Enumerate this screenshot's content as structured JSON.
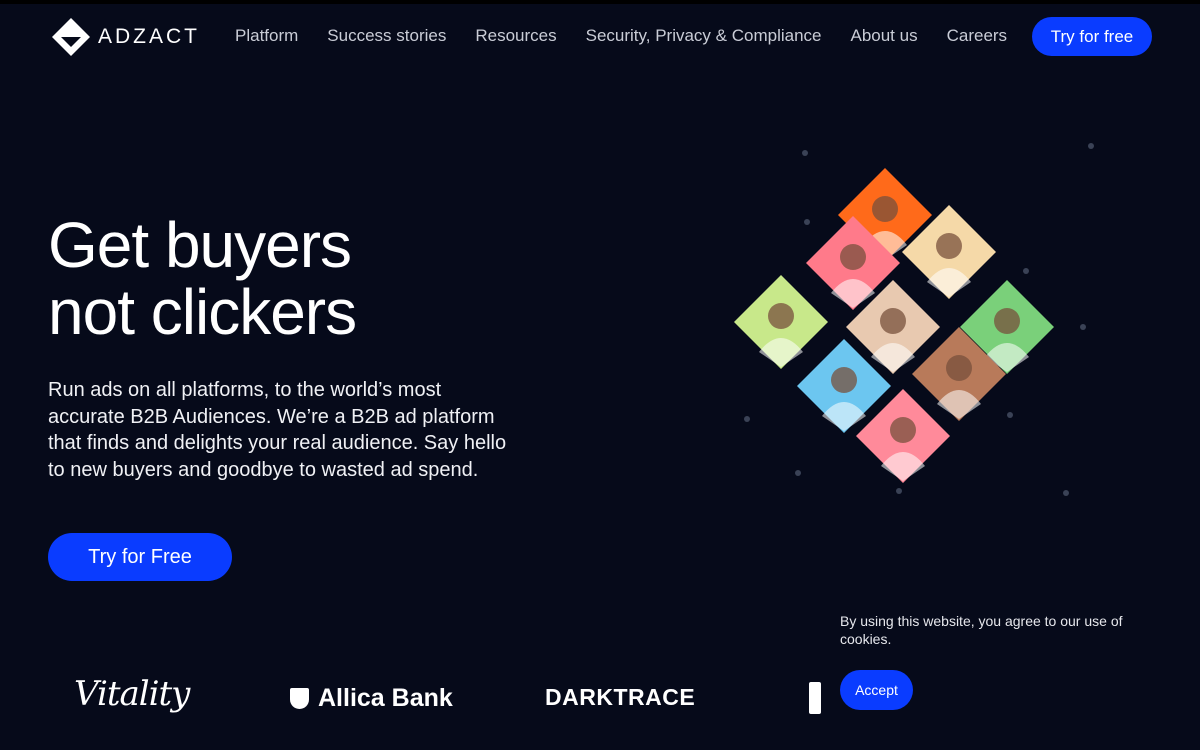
{
  "brand": {
    "name": "ADZACT",
    "accent_color": "#0a3cff",
    "background_color": "#060a1a"
  },
  "nav": {
    "links": [
      {
        "label": "Platform"
      },
      {
        "label": "Success stories"
      },
      {
        "label": "Resources"
      },
      {
        "label": "Security, Privacy & Compliance"
      },
      {
        "label": "About us"
      },
      {
        "label": "Careers"
      }
    ],
    "cta_label": "Try for free"
  },
  "hero": {
    "title_line1": "Get buyers",
    "title_line2": "not clickers",
    "description": "Run ads on all platforms, to the world’s most accurate B2B Audiences. We’re a B2B ad platform that finds and delights your real audience. Say hello to new buyers and goodbye to wasted ad spend.",
    "cta_label": "Try for Free"
  },
  "collage": {
    "tile_colors": [
      "#ff6a1a",
      "#ff7a8a",
      "#f5d9a8",
      "#c8e88a",
      "#e8c9b0",
      "#7ad07a",
      "#6cc6f0",
      "#b87a5a",
      "#ff8a9a"
    ]
  },
  "client_logos": [
    {
      "name": "Vitality"
    },
    {
      "name": "Allica Bank"
    },
    {
      "name": "DARKTRACE"
    }
  ],
  "cookie": {
    "message": "By using this website, you agree to our use of cookies.",
    "accept_label": "Accept"
  }
}
